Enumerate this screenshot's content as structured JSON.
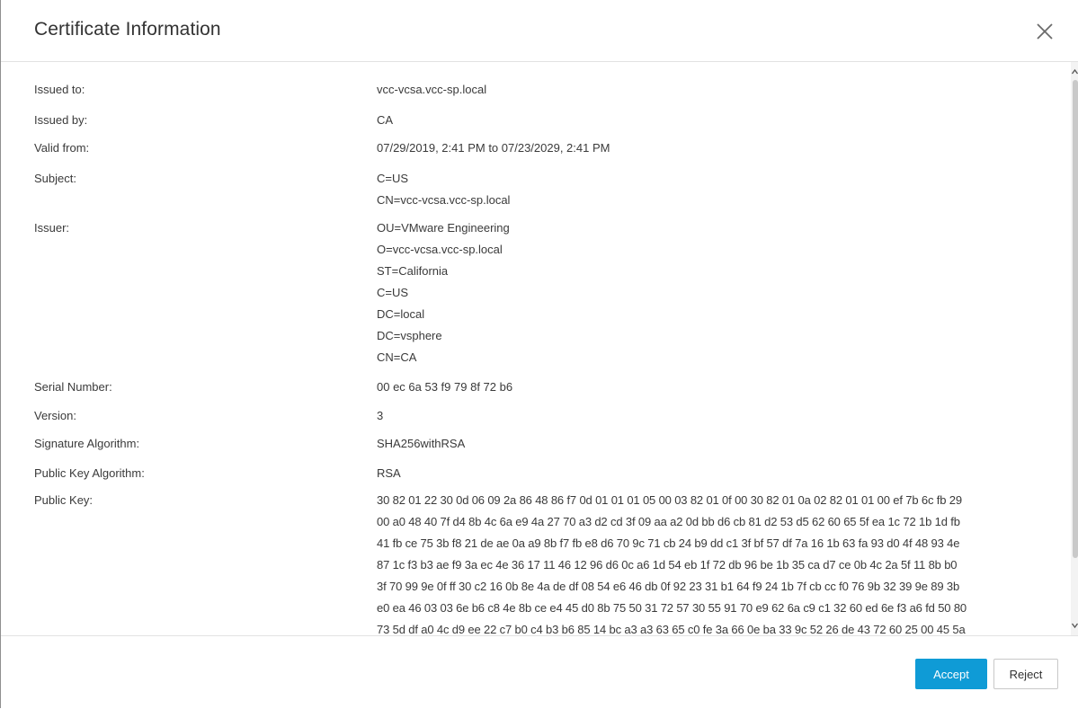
{
  "dialog": {
    "title": "Certificate Information",
    "close_icon": "close-icon"
  },
  "fields": {
    "issued_to": {
      "label": "Issued to:",
      "value": "vcc-vcsa.vcc-sp.local"
    },
    "issued_by": {
      "label": "Issued by:",
      "value": "CA"
    },
    "valid_from": {
      "label": "Valid from:",
      "value": "07/29/2019, 2:41 PM to 07/23/2029, 2:41 PM"
    },
    "subject": {
      "label": "Subject:",
      "lines": [
        "C=US",
        "CN=vcc-vcsa.vcc-sp.local"
      ]
    },
    "issuer": {
      "label": "Issuer:",
      "lines": [
        "OU=VMware Engineering",
        "O=vcc-vcsa.vcc-sp.local",
        "ST=California",
        "C=US",
        "DC=local",
        "DC=vsphere",
        "CN=CA"
      ]
    },
    "serial_number": {
      "label": "Serial Number:",
      "value": "00 ec 6a 53 f9 79 8f 72 b6"
    },
    "version": {
      "label": "Version:",
      "value": "3"
    },
    "signature_algorithm": {
      "label": "Signature Algorithm:",
      "value": "SHA256withRSA"
    },
    "public_key_algorithm": {
      "label": "Public Key Algorithm:",
      "value": "RSA"
    },
    "public_key": {
      "label": "Public Key:",
      "lines": [
        "30 82 01 22 30 0d 06 09 2a 86 48 86 f7 0d 01 01 01 05 00 03 82 01 0f 00 30 82 01 0a 02 82 01 01 00 ef 7b 6c fb 29",
        "00 a0 48 40 7f d4 8b 4c 6a e9 4a 27 70 a3 d2 cd 3f 09 aa a2 0d bb d6 cb 81 d2 53 d5 62 60 65 5f ea 1c 72 1b 1d fb",
        "41 fb ce 75 3b f8 21 de ae 0a a9 8b f7 fb e8 d6 70 9c 71 cb 24 b9 dd c1 3f bf 57 df 7a 16 1b 63 fa 93 d0 4f 48 93 4e",
        "87 1c f3 b3 ae f9 3a ec 4e 36 17 11 46 12 96 d6 0c a6 1d 54 eb 1f 72 db 96 be 1b 35 ca d7 ce 0b 4c 2a 5f 11 8b b0",
        "3f 70 99 9e 0f ff 30 c2 16 0b 8e 4a de df 08 54 e6 46 db 0f 92 23 31 b1 64 f9 24 1b 7f cb cc f0 76 9b 32 39 9e 89 3b",
        "e0 ea 46 03 03 6e b6 c8 4e 8b ce e4 45 d0 8b 75 50 31 72 57 30 55 91 70 e9 62 6a c9 c1 32 60 ed 6e f3 a6 fd 50 80",
        "73 5d df a0 4c d9 ee 22 c7 b0 c4 b3 b6 85 14 bc a3 a3 63 65 c0 fe 3a 66 0e ba 33 9c 52 26 de 43 72 60 25 00 45 5a"
      ]
    }
  },
  "footer": {
    "accept_label": "Accept",
    "reject_label": "Reject"
  },
  "colors": {
    "accent": "#0f9bd6",
    "text": "#3a3a3a",
    "divider": "#e2e2e2"
  }
}
